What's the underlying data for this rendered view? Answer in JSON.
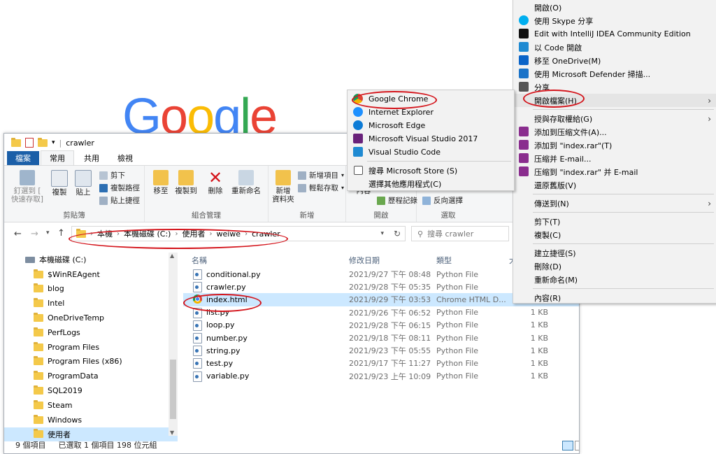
{
  "google_logo": {
    "letters": [
      "G",
      "o",
      "o",
      "g",
      "l",
      "e"
    ],
    "colors": [
      "#4285f4",
      "#ea4335",
      "#fbbc05",
      "#4285f4",
      "#34a853",
      "#ea4335"
    ]
  },
  "explorer": {
    "title": "crawler",
    "tabs": [
      "檔案",
      "常用",
      "共用",
      "檢視"
    ],
    "ribbon": {
      "clipboard": {
        "pin": "釘選到 [\n快速存取]",
        "copy": "複製",
        "paste": "貼上",
        "cut": "剪下",
        "copy_path": "複製路徑",
        "paste_shortcut": "貼上捷徑",
        "group": "剪貼簿"
      },
      "organize": {
        "move_to": "移至",
        "copy_to": "複製到",
        "delete": "刪除",
        "rename": "重新命名",
        "group": "組合管理"
      },
      "new": {
        "new_folder": "新增\n資料夾",
        "new_item": "新增項目",
        "easy_access": "輕鬆存取",
        "group": "新增"
      },
      "open": {
        "properties": "內容",
        "history": "歷程記錄",
        "group": "開啟"
      },
      "select": {
        "invert": "反向選擇",
        "group": "選取"
      }
    },
    "address": {
      "path": [
        "本機",
        "本機磁碟 (C:)",
        "使用者",
        "weiwe",
        "crawler"
      ],
      "search_placeholder": "搜尋 crawler"
    },
    "nav": {
      "root": "本機磁碟 (C:)",
      "items": [
        "$WinREAgent",
        "blog",
        "Intel",
        "OneDriveTemp",
        "PerfLogs",
        "Program Files",
        "Program Files (x86)",
        "ProgramData",
        "SQL2019",
        "Steam",
        "Windows",
        "使用者"
      ]
    },
    "columns": [
      "名稱",
      "修改日期",
      "類型",
      "大"
    ],
    "files": [
      {
        "name": "conditional.py",
        "date": "2021/9/27 下午 08:48",
        "type": "Python File",
        "size": ""
      },
      {
        "name": "crawler.py",
        "date": "2021/9/28 下午 05:35",
        "type": "Python File",
        "size": ""
      },
      {
        "name": "index.html",
        "date": "2021/9/29 下午 03:53",
        "type": "Chrome HTML D...",
        "size": "1 KB"
      },
      {
        "name": "list.py",
        "date": "2021/9/26 下午 06:52",
        "type": "Python File",
        "size": "1 KB"
      },
      {
        "name": "loop.py",
        "date": "2021/9/28 下午 06:15",
        "type": "Python File",
        "size": "1 KB"
      },
      {
        "name": "number.py",
        "date": "2021/9/18 下午 08:11",
        "type": "Python File",
        "size": "1 KB"
      },
      {
        "name": "string.py",
        "date": "2021/9/23 下午 05:55",
        "type": "Python File",
        "size": "1 KB"
      },
      {
        "name": "test.py",
        "date": "2021/9/17 下午 11:27",
        "type": "Python File",
        "size": "1 KB"
      },
      {
        "name": "variable.py",
        "date": "2021/9/23 上午 10:09",
        "type": "Python File",
        "size": "1 KB"
      }
    ],
    "status": {
      "count": "9 個項目",
      "selected": "已選取 1 個項目 198 位元組"
    }
  },
  "context_menu": {
    "items": [
      {
        "label": "開啟(O)",
        "icon": "none"
      },
      {
        "label": "使用 Skype 分享",
        "icon": "skype"
      },
      {
        "label": "Edit with IntelliJ IDEA Community Edition",
        "icon": "intellij"
      },
      {
        "label": "以 Code 開啟",
        "icon": "vscode"
      },
      {
        "label": "移至 OneDrive(M)",
        "icon": "onedrive"
      },
      {
        "label": "使用 Microsoft Defender 掃描...",
        "icon": "defender"
      },
      {
        "label": "分享",
        "icon": "share"
      },
      {
        "label": "開啟檔案(H)",
        "icon": "none",
        "submenu": true
      }
    ],
    "items2": [
      {
        "label": "授與存取權給(G)",
        "icon": "none",
        "submenu": true
      },
      {
        "label": "添加到压缩文件(A)...",
        "icon": "winrar"
      },
      {
        "label": "添加到 \"index.rar\"(T)",
        "icon": "winrar"
      },
      {
        "label": "压缩并 E-mail...",
        "icon": "winrar"
      },
      {
        "label": "压缩到 \"index.rar\" 并 E-mail",
        "icon": "winrar"
      },
      {
        "label": "還原舊版(V)",
        "icon": "none"
      }
    ],
    "items3": [
      {
        "label": "傳送到(N)",
        "submenu": true
      }
    ],
    "items4": [
      {
        "label": "剪下(T)"
      },
      {
        "label": "複製(C)"
      }
    ],
    "items5": [
      {
        "label": "建立捷徑(S)"
      },
      {
        "label": "刪除(D)"
      },
      {
        "label": "重新命名(M)"
      }
    ],
    "items6": [
      {
        "label": "內容(R)"
      }
    ]
  },
  "open_with_menu": {
    "apps": [
      {
        "label": "Google Chrome",
        "icon": "chrome"
      },
      {
        "label": "Internet Explorer",
        "icon": "ie"
      },
      {
        "label": "Microsoft Edge",
        "icon": "edge"
      },
      {
        "label": "Microsoft Visual Studio 2017",
        "icon": "vs"
      },
      {
        "label": "Visual Studio Code",
        "icon": "vscode"
      }
    ],
    "store": "搜尋 Microsoft Store (S)",
    "other": "選擇其他應用程式(C)"
  }
}
